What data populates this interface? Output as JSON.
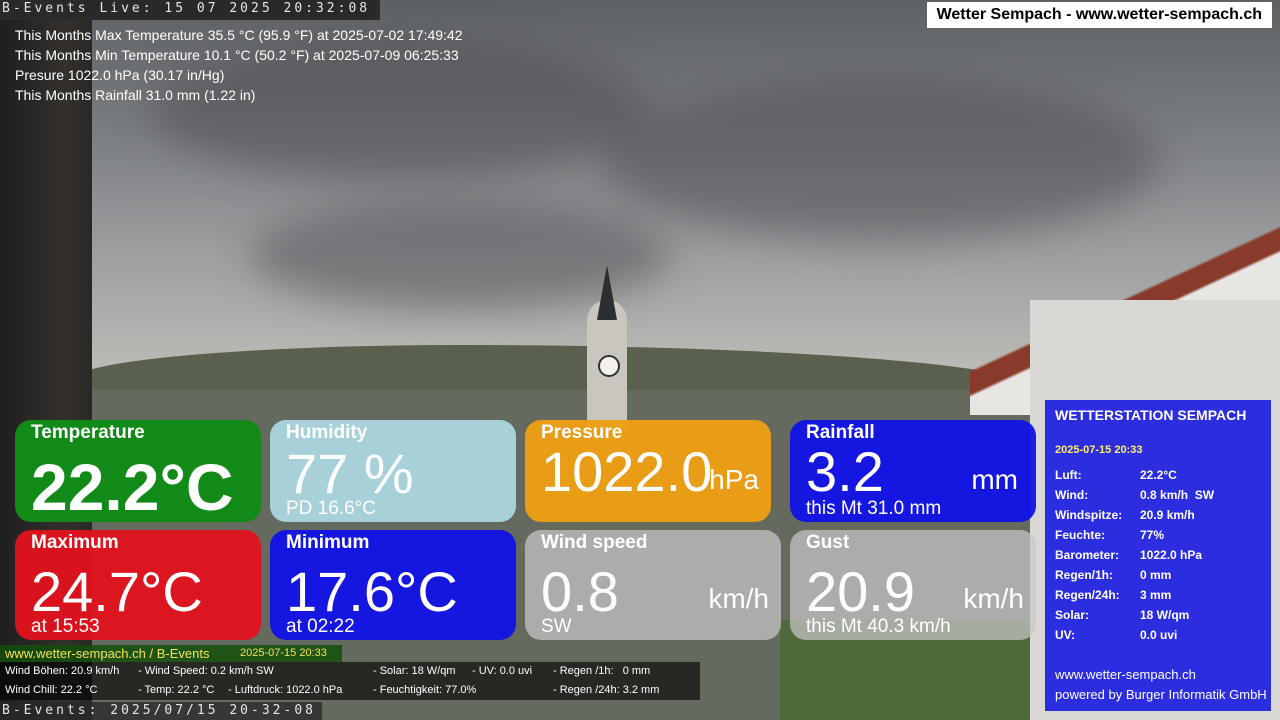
{
  "overlay": {
    "top_timestamp": "B-Events Live: 15 07 2025 20:32:08",
    "bottom_timestamp": "B-Events: 2025/07/15 20-32-08",
    "title": "Wetter Sempach - www.wetter-sempach.ch",
    "stats": [
      "This Months Max Temperature 35.5 °C (95.9 °F) at 2025-07-02 17:49:42",
      "This Months Min Temperature 10.1 °C (50.2 °F) at 2025-07-09 06:25:33",
      "Presure 1022.0 hPa (30.17 in/Hg)",
      "This Months Rainfall 31.0 mm (1.22 in)"
    ]
  },
  "tiles": {
    "temperature": {
      "label": "Temperature",
      "value": "22.2°C",
      "color": "#118a18"
    },
    "humidity": {
      "label": "Humidity",
      "value": "77 %",
      "sub": "PD 16.6°C",
      "color": "#acd8e2"
    },
    "pressure": {
      "label": "Pressure",
      "value": "1022.0",
      "unit": "hPa",
      "color": "#ee9e12"
    },
    "rainfall": {
      "label": "Rainfall",
      "value": "3.2",
      "unit": "mm",
      "sub": "this Mt 31.0 mm",
      "color": "#1212e8"
    },
    "maximum": {
      "label": "Maximum",
      "value": "24.7°C",
      "sub": "at 15:53",
      "color": "#e2121c"
    },
    "minimum": {
      "label": "Minimum",
      "value": "17.6°C",
      "sub": "at 02:22",
      "color": "#1212e8"
    },
    "wind_speed": {
      "label": "Wind speed",
      "value": "0.8",
      "unit": "km/h",
      "sub": "SW",
      "color": "#c8c8c8"
    },
    "gust": {
      "label": "Gust",
      "value": "20.9",
      "unit": "km/h",
      "sub": "this Mt 40.3 km/h",
      "color": "#c8c8c8"
    }
  },
  "panel": {
    "title": "WETTERSTATION SEMPACH",
    "date": "2025-07-15 20:33",
    "rows": [
      {
        "key": "Luft:",
        "value": "22.2°C"
      },
      {
        "key": "Wind:",
        "value": "0.8 km/h  SW"
      },
      {
        "key": "Windspitze:",
        "value": "20.9 km/h"
      },
      {
        "key": "Feuchte:",
        "value": "77%"
      },
      {
        "key": "Barometer:",
        "value": "1022.0 hPa"
      },
      {
        "key": "Regen/1h:",
        "value": "0 mm"
      },
      {
        "key": "Regen/24h:",
        "value": "3 mm"
      },
      {
        "key": "Solar:",
        "value": "18 W/qm"
      },
      {
        "key": "UV:",
        "value": "0.0 uvi"
      }
    ],
    "site": "www.wetter-sempach.ch",
    "powered": "powered by Burger Informatik GmbH"
  },
  "ticker": {
    "site": "www.wetter-sempach.ch / B-Events",
    "date": "2025-07-15 20:33",
    "line1": {
      "wind_gusts": "Wind Böhen: 20.9 km/h",
      "wind_speed": "- Wind Speed: 0.2 km/h SW",
      "solar": "- Solar: 18 W/qm",
      "uv": "- UV: 0.0 uvi",
      "rain_1h": "- Regen /1h:   0 mm"
    },
    "line2": {
      "wind_chill": "Wind Chill: 22.2 °C",
      "temp": "- Temp: 22.2 °C",
      "pressure": "- Luftdruck: 1022.0 hPa",
      "humidity": "- Feuchtigkeit: 77.0%",
      "rain_24h": "- Regen /24h: 3.2 mm"
    }
  }
}
